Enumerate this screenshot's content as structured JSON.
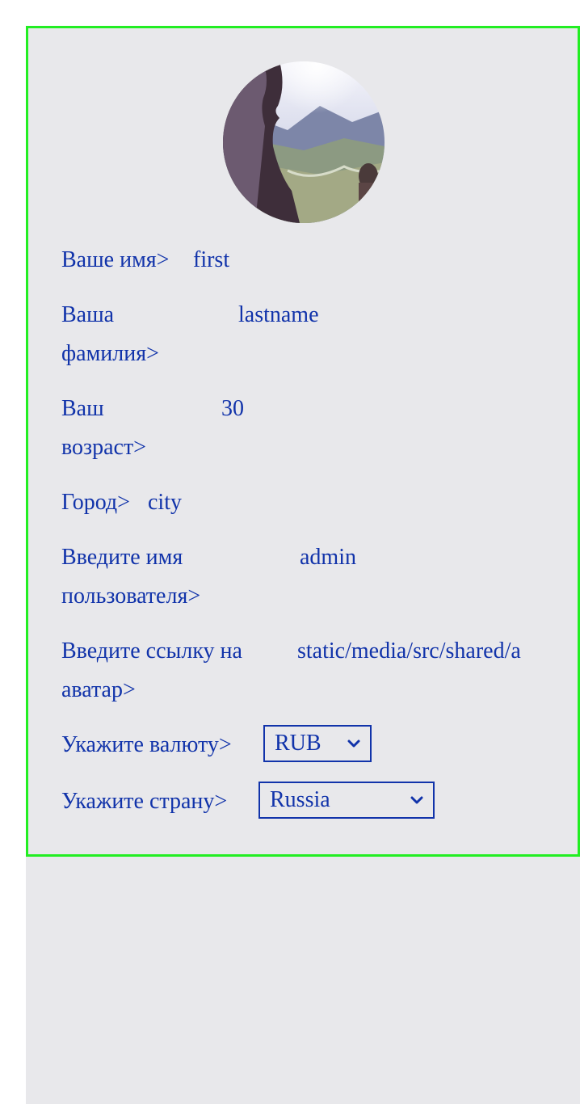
{
  "profile": {
    "avatar_icon": "profile-photo",
    "fields": [
      {
        "label": "Ваше имя>",
        "value": "first"
      },
      {
        "label": "Ваша фамилия>",
        "value": "lastname"
      },
      {
        "label": "Ваш возраст>",
        "value": "30"
      },
      {
        "label": "Город>",
        "value": "city"
      },
      {
        "label": "Введите имя пользователя>",
        "value": "admin"
      },
      {
        "label": "Введите ссылку на аватар>",
        "value": "static/media/src/shared/a"
      }
    ],
    "currency": {
      "label": "Укажите валюту>",
      "selected": "RUB"
    },
    "country": {
      "label": "Укажите страну>",
      "selected": "Russia"
    }
  },
  "colors": {
    "text": "#1133aa",
    "card_border": "#22ee22",
    "background": "#e8e8eb"
  }
}
